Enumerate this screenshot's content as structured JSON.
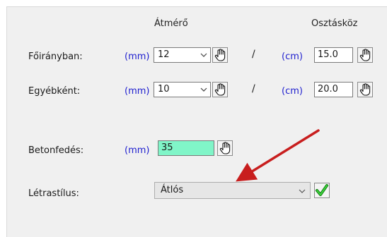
{
  "header": {
    "diameter_label": "Átmérő",
    "spacing_label": "Osztásköz"
  },
  "rows": [
    {
      "label": "Főirányban:",
      "diameter_unit": "(mm)",
      "diameter_value": "12",
      "separator": "/",
      "spacing_unit": "(cm)",
      "spacing_value": "15.0"
    },
    {
      "label": "Egyébként:",
      "diameter_unit": "(mm)",
      "diameter_value": "10",
      "separator": "/",
      "spacing_unit": "(cm)",
      "spacing_value": "20.0"
    }
  ],
  "cover": {
    "label": "Betonfedés:",
    "unit": "(mm)",
    "value": "35",
    "highlight_color": "#80f5c8"
  },
  "ladder": {
    "label": "Létrastílus:",
    "value": "Átlós"
  },
  "annotation": {
    "arrow_color": "#c81e1e"
  },
  "icons": {
    "pick": "hand-pointer-icon",
    "dropdown": "chevron-down-icon",
    "confirm": "green-checkmark-icon"
  }
}
